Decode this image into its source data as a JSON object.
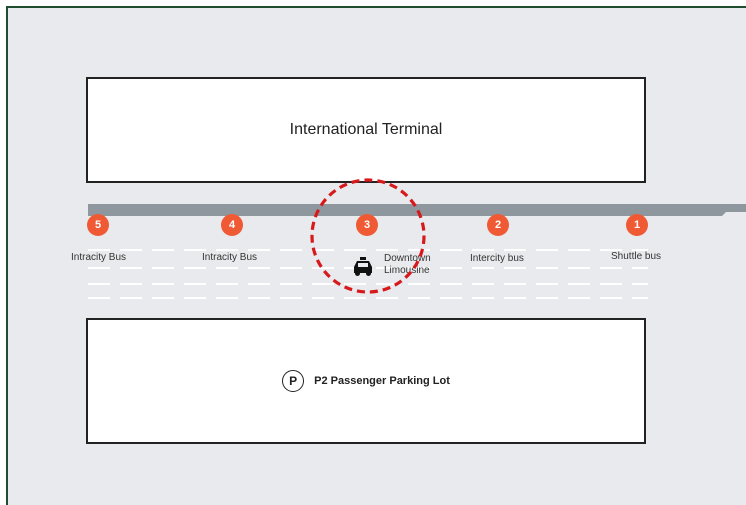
{
  "terminal": {
    "name": "International Terminal"
  },
  "parking": {
    "badge": "P",
    "name": "P2 Passenger Parking Lot"
  },
  "stops": [
    {
      "number": "5",
      "label": "Intracity Bus"
    },
    {
      "number": "4",
      "label": "Intracity Bus"
    },
    {
      "number": "3",
      "label_line1": "Downtown",
      "label_line2": "Limousine"
    },
    {
      "number": "2",
      "label": "Intercity bus"
    },
    {
      "number": "1",
      "label": "Shuttle bus"
    }
  ],
  "highlighted_stop": "3",
  "icons": {
    "stop_3": "taxi-icon",
    "parking": "parking-icon"
  },
  "colors": {
    "stop_badge": "#ef5a35",
    "highlight_ring": "#d7191c",
    "curb": "#8e979d",
    "frame": "#1f4e2f"
  }
}
